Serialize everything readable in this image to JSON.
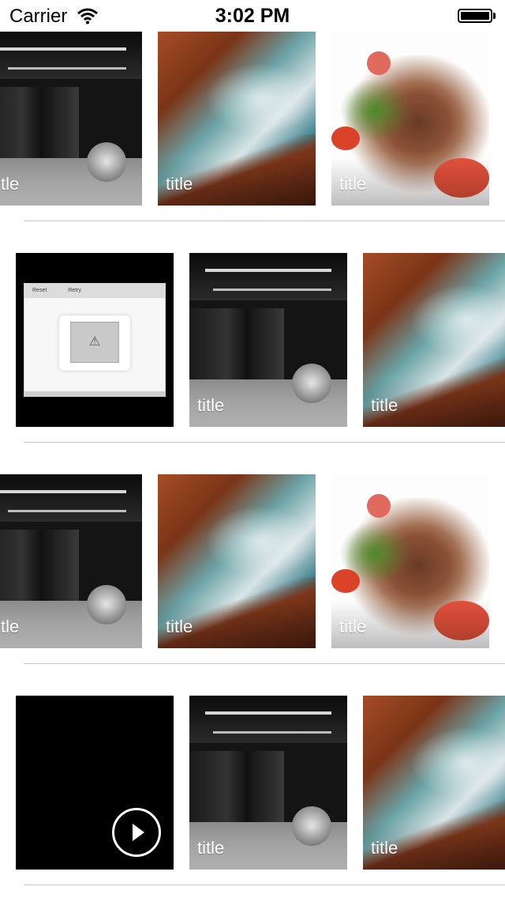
{
  "status_bar": {
    "carrier": "Carrier",
    "time": "3:02 PM",
    "battery_level": 1.0
  },
  "item_title": "title",
  "error_placeholder": {
    "reset_label": "Reset",
    "retry_label": "Retry",
    "icon": "warning-icon"
  },
  "rows": [
    {
      "cells": [
        "bar-scene",
        "coastal-rocks",
        "food-plate"
      ]
    },
    {
      "cells": [
        "error-placeholder",
        "bar-scene",
        "coastal-rocks"
      ]
    },
    {
      "cells": [
        "bar-scene",
        "coastal-rocks",
        "food-plate"
      ]
    },
    {
      "cells": [
        "video-placeholder",
        "bar-scene",
        "coastal-rocks"
      ]
    }
  ],
  "colors": {
    "divider": "#c8c7cc",
    "background": "#ffffff",
    "title_text": "#ffffff"
  }
}
